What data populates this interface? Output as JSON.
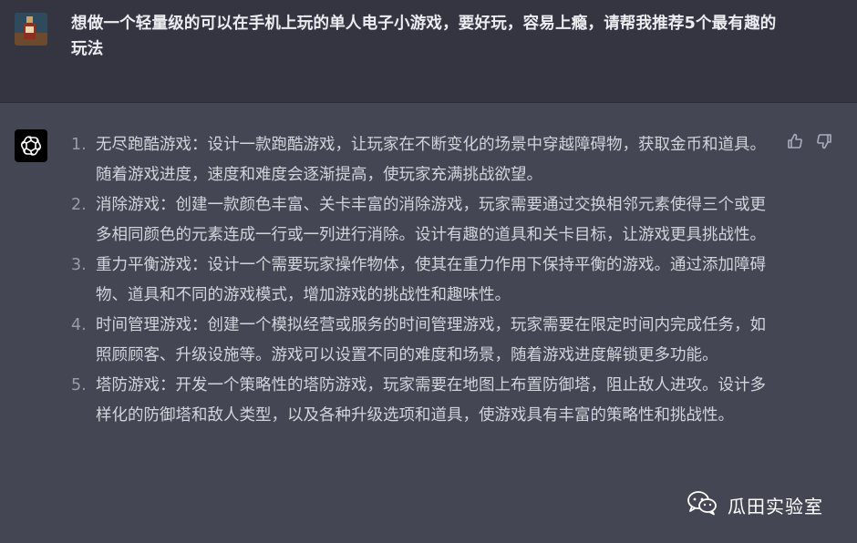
{
  "user_message": {
    "text": "想做一个轻量级的可以在手机上玩的单人电子小游戏，要好玩，容易上瘾，请帮我推荐5个最有趣的玩法"
  },
  "assistant_message": {
    "items": [
      {
        "num": "1.",
        "text": "无尽跑酷游戏：设计一款跑酷游戏，让玩家在不断变化的场景中穿越障碍物，获取金币和道具。随着游戏进度，速度和难度会逐渐提高，使玩家充满挑战欲望。"
      },
      {
        "num": "2.",
        "text": "消除游戏：创建一款颜色丰富、关卡丰富的消除游戏，玩家需要通过交换相邻元素使得三个或更多相同颜色的元素连成一行或一列进行消除。设计有趣的道具和关卡目标，让游戏更具挑战性。"
      },
      {
        "num": "3.",
        "text": "重力平衡游戏：设计一个需要玩家操作物体，使其在重力作用下保持平衡的游戏。通过添加障碍物、道具和不同的游戏模式，增加游戏的挑战性和趣味性。"
      },
      {
        "num": "4.",
        "text": "时间管理游戏：创建一个模拟经营或服务的时间管理游戏，玩家需要在限定时间内完成任务，如照顾顾客、升级设施等。游戏可以设置不同的难度和场景，随着游戏进度解锁更多功能。"
      },
      {
        "num": "5.",
        "text": "塔防游戏：开发一个策略性的塔防游戏，玩家需要在地图上布置防御塔，阻止敌人进攻。设计多样化的防御塔和敌人类型，以及各种升级选项和道具，使游戏具有丰富的策略性和挑战性。"
      }
    ]
  },
  "icons": {
    "assistant_avatar": "openai-logo-icon",
    "thumbs_up": "thumbs-up-icon",
    "thumbs_down": "thumbs-down-icon",
    "watermark_logo": "wechat-icon"
  },
  "watermark": {
    "text": "瓜田实验室"
  },
  "colors": {
    "user_bg": "#343541",
    "assistant_bg": "#444654",
    "text_primary": "#ececf1",
    "text_answer": "#d1d5db"
  }
}
